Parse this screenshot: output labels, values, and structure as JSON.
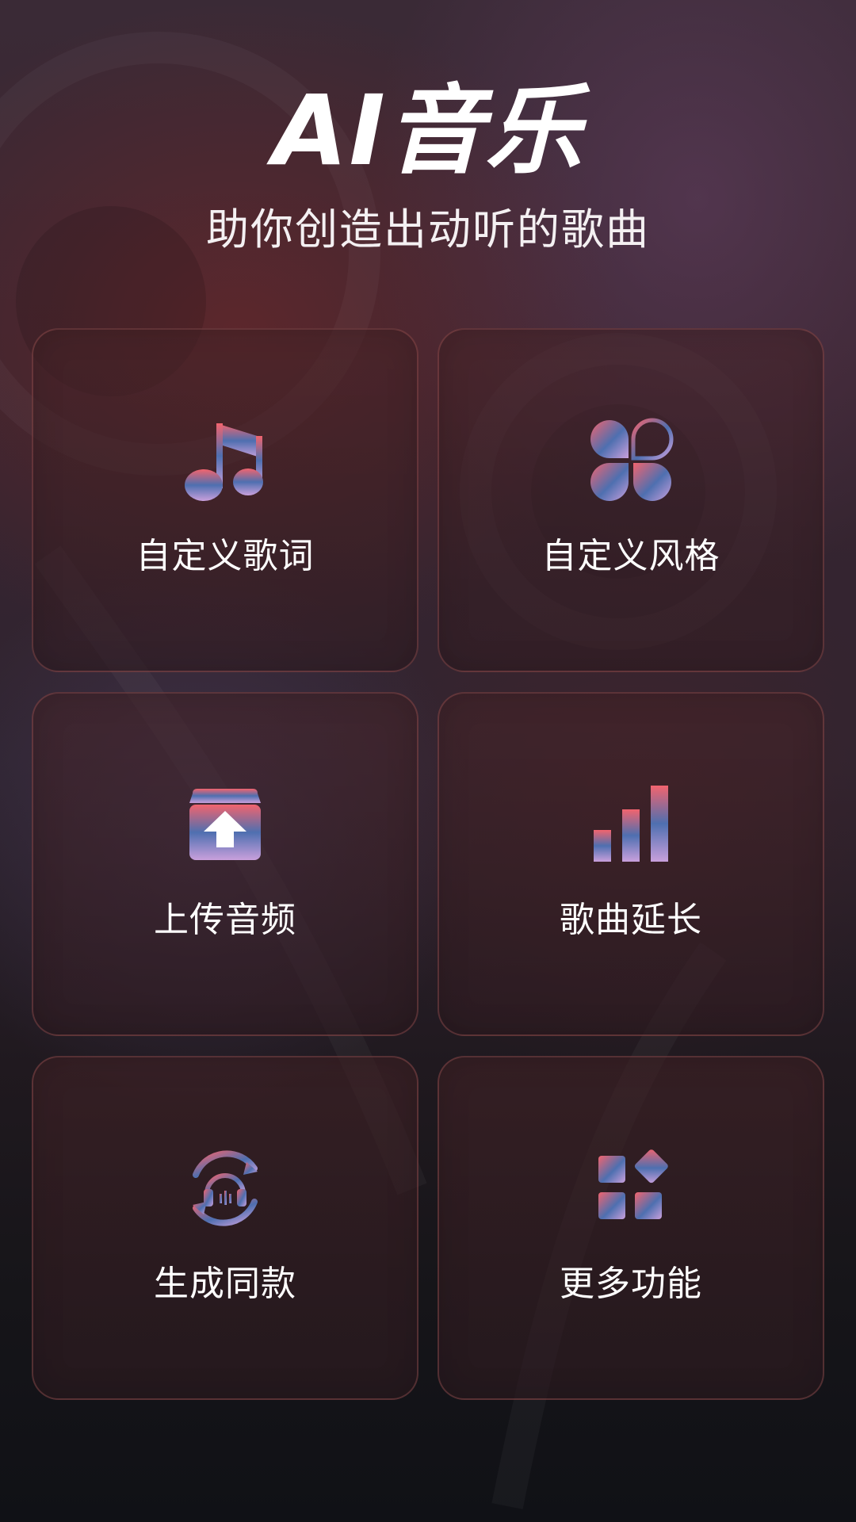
{
  "header": {
    "title": "AI音乐",
    "subtitle": "助你创造出动听的歌曲"
  },
  "colors": {
    "icon_gradient_top": "#f2646e",
    "icon_gradient_mid": "#4e6fb0",
    "icon_gradient_bottom": "#c9a0dc"
  },
  "features": [
    {
      "label": "自定义歌词",
      "icon": "music-note-icon"
    },
    {
      "label": "自定义风格",
      "icon": "style-petals-icon"
    },
    {
      "label": "上传音频",
      "icon": "upload-box-icon"
    },
    {
      "label": "歌曲延长",
      "icon": "signal-bars-icon"
    },
    {
      "label": "生成同款",
      "icon": "headphones-sync-icon"
    },
    {
      "label": "更多功能",
      "icon": "more-apps-icon"
    }
  ]
}
